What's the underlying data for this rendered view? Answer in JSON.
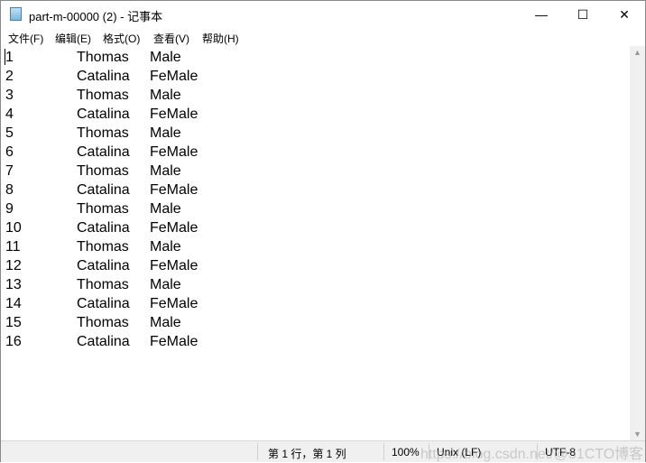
{
  "window": {
    "title": "part-m-00000 (2) - 记事本",
    "minimize": "—",
    "maximize": "☐",
    "close": "✕"
  },
  "menu": [
    "文件(F)",
    "编辑(E)",
    "格式(O)",
    "查看(V)",
    "帮助(H)"
  ],
  "lines": [
    [
      "1",
      "Thomas",
      "Male"
    ],
    [
      "2",
      "Catalina",
      "FeMale"
    ],
    [
      "3",
      "Thomas",
      "Male"
    ],
    [
      "4",
      "Catalina",
      "FeMale"
    ],
    [
      "5",
      "Thomas",
      "Male"
    ],
    [
      "6",
      "Catalina",
      "FeMale"
    ],
    [
      "7",
      "Thomas",
      "Male"
    ],
    [
      "8",
      "Catalina",
      "FeMale"
    ],
    [
      "9",
      "Thomas",
      "Male"
    ],
    [
      "10",
      "Catalina",
      "FeMale"
    ],
    [
      "11",
      "Thomas",
      "Male"
    ],
    [
      "12",
      "Catalina",
      "FeMale"
    ],
    [
      "13",
      "Thomas",
      "Male"
    ],
    [
      "14",
      "Catalina",
      "FeMale"
    ],
    [
      "15",
      "Thomas",
      "Male"
    ],
    [
      "16",
      "Catalina",
      "FeMale"
    ]
  ],
  "status": {
    "position": "第 1 行，第 1 列",
    "zoom": "100%",
    "line_ending": "Unix (LF)",
    "encoding": "UTF-8"
  },
  "watermark": "https://blog.csdn.net/@51CTO博客"
}
